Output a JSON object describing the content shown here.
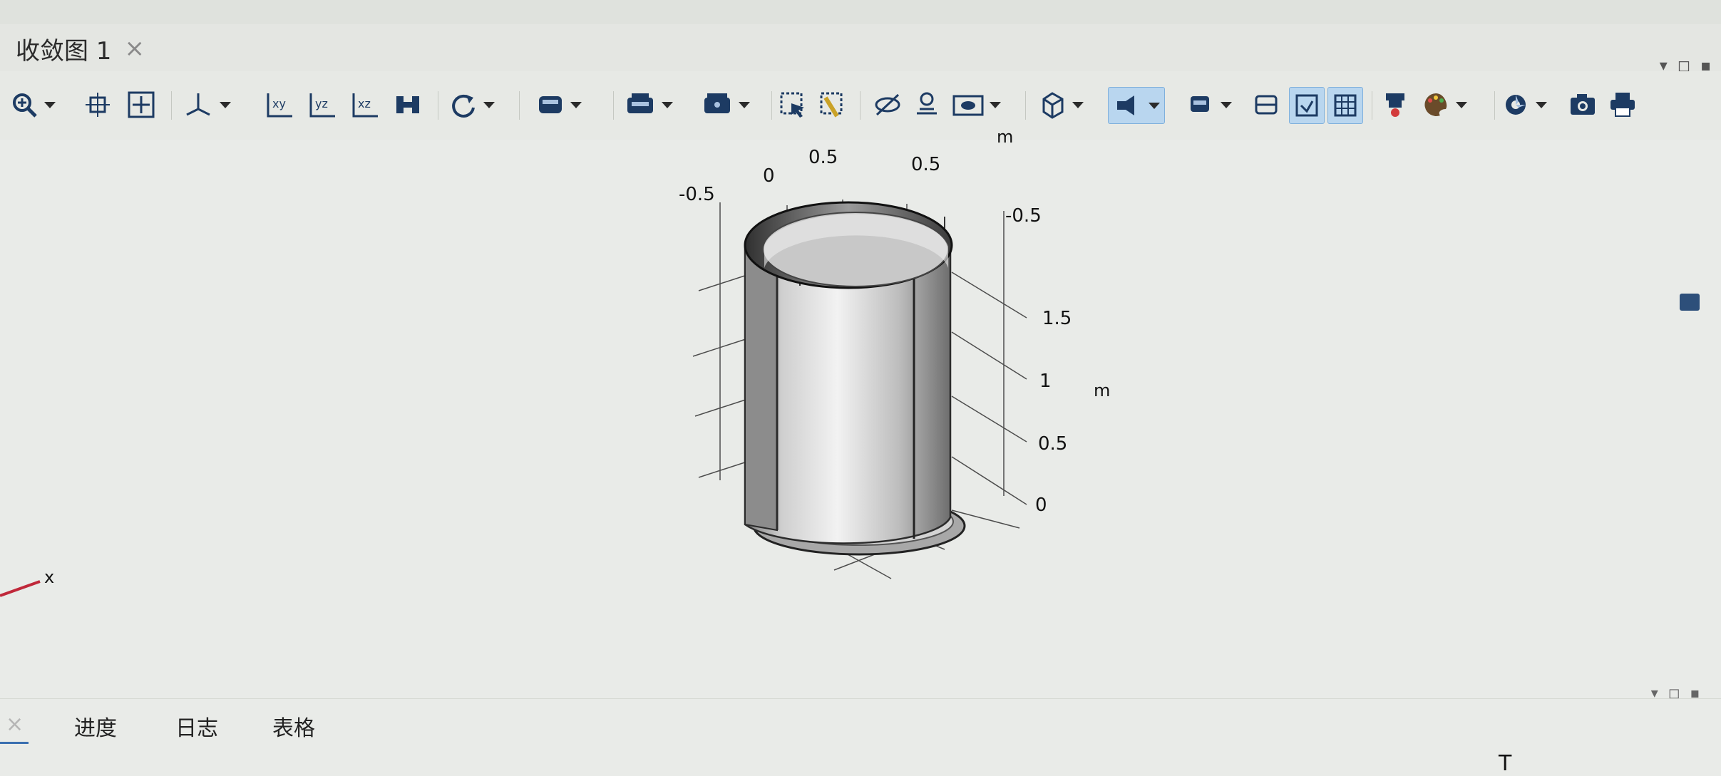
{
  "window": {
    "tab_title": "收敛图 1",
    "tab_close": "×"
  },
  "window_controls": [
    "▾",
    "◻",
    "▪"
  ],
  "toolbar": {
    "icons": [
      "zoom-icon",
      "zoom-extents-icon",
      "zoom-box-icon",
      "axis-orient-icon",
      "xy-view-icon",
      "yz-view-icon",
      "xz-view-icon",
      "default-view-icon",
      "rotate-icon",
      "render-mode-icon",
      "select-box-icon",
      "select-objects-icon",
      "wireframe-icon",
      "transparency-icon",
      "hide-icon",
      "show-icon",
      "camera-view-icon",
      "grid-icon",
      "light-icon",
      "scene-icon",
      "plane-icon",
      "wire-icon",
      "grid-toggle-icon",
      "color-icon",
      "palette-icon",
      "settings-icon",
      "screenshot-icon",
      "print-icon"
    ]
  },
  "plot": {
    "x_ticks_top": [
      "-0.5",
      "0",
      "0.5",
      "0.5",
      "-0.5"
    ],
    "z_ticks": [
      "1.5",
      "1",
      "0.5",
      "0"
    ],
    "unit_top": "m",
    "unit_right": "m",
    "axis_label": "x"
  },
  "bottom_tabs": {
    "close": "×",
    "items": [
      "进度",
      "日志",
      "表格"
    ]
  },
  "cursor_glyph": "T"
}
